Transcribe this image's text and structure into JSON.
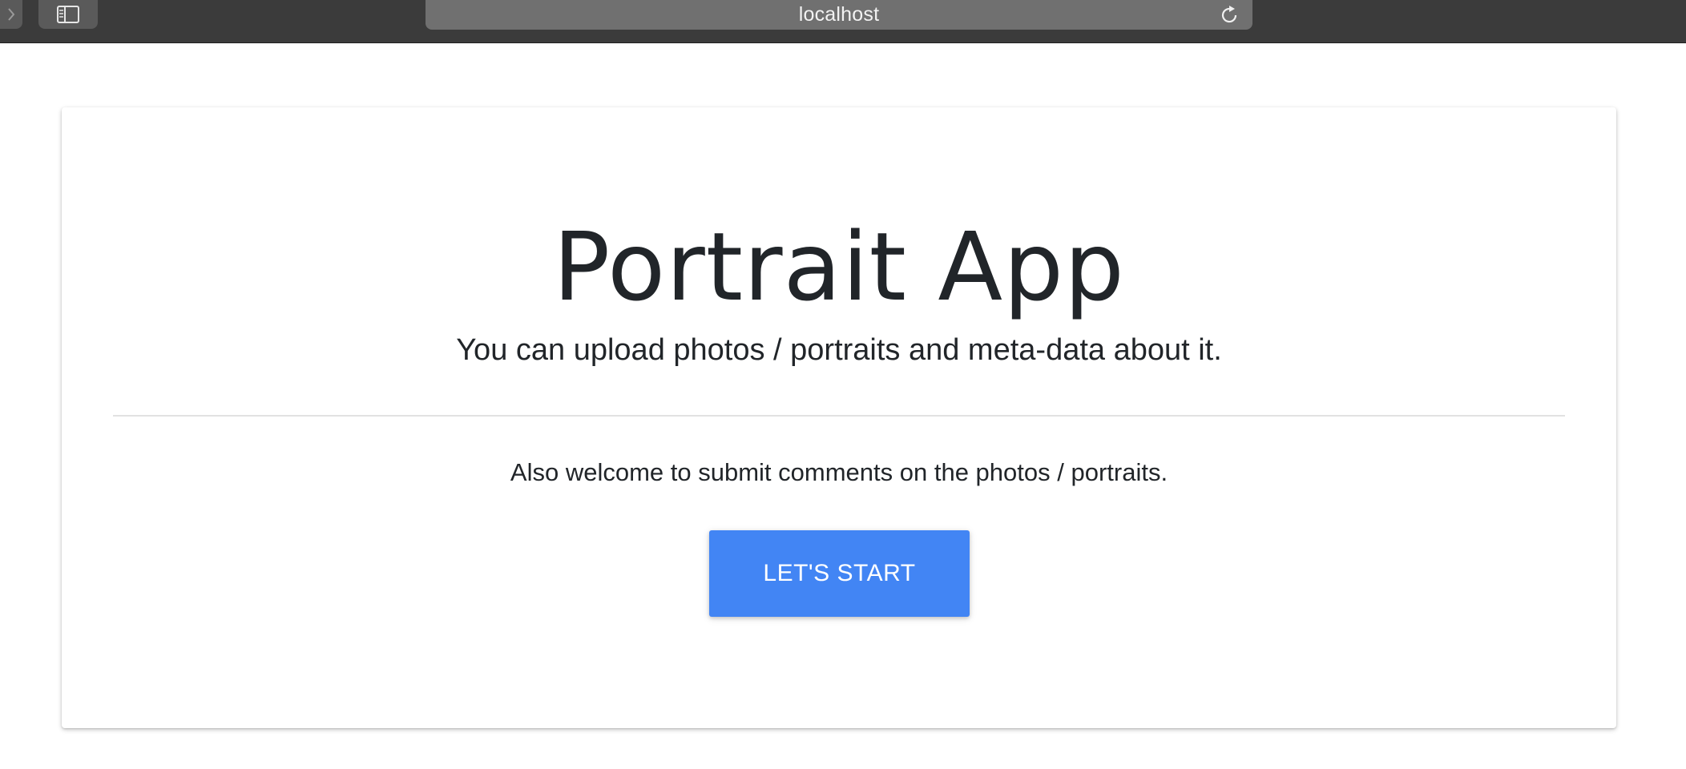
{
  "browser": {
    "address": "localhost",
    "icons": {
      "forward": "chevron-right-icon",
      "sidebar": "sidebar-icon",
      "reload": "reload-icon"
    }
  },
  "hero": {
    "title": "Portrait App",
    "lead": "You can upload photos / portraits and meta-data about it.",
    "subtext": "Also welcome to submit comments on the photos / portraits.",
    "button_label": "LET'S START"
  },
  "colors": {
    "browser_chrome": "#3b3b3b",
    "address_bar": "#707070",
    "primary_button": "#4285f4",
    "text": "#212529"
  }
}
